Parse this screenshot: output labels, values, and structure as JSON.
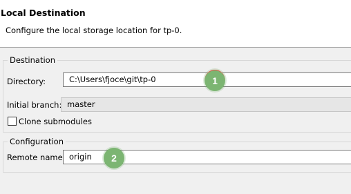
{
  "header": {
    "title": "Local Destination",
    "description": "Configure the local storage location for tp-0."
  },
  "destination": {
    "legend": "Destination",
    "directory_label": "Directory:",
    "directory_value": "C:\\Users\\fjoce\\git\\tp-0",
    "initial_branch_label": "Initial branch:",
    "initial_branch_value": "master",
    "clone_submodules_label": "Clone submodules",
    "clone_submodules_checked": false
  },
  "configuration": {
    "legend": "Configuration",
    "remote_name_label": "Remote name:",
    "remote_name_value": "origin"
  },
  "callouts": [
    {
      "label": "1",
      "color": "#7cb572"
    },
    {
      "label": "2",
      "color": "#7cb572"
    }
  ]
}
